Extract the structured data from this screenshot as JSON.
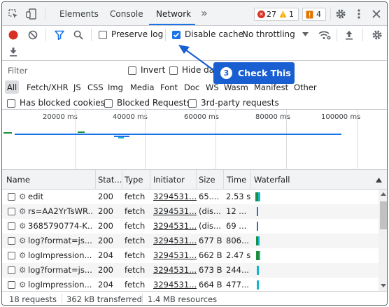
{
  "tabs": {
    "items": [
      {
        "label": "Elements"
      },
      {
        "label": "Console"
      },
      {
        "label": "Network"
      }
    ],
    "more": "»",
    "errors_count": "27",
    "warnings_count": "1",
    "issues_count": "4"
  },
  "toolbar": {
    "preserve_log": "Preserve log",
    "disable_cache": "Disable cache",
    "throttling": "No throttling"
  },
  "callout": {
    "step": "3",
    "text": "Check This"
  },
  "filter": {
    "placeholder": "Filter",
    "invert": "Invert",
    "hide_data": "Hide dat",
    "types": [
      "All",
      "Fetch/XHR",
      "JS",
      "CSS",
      "Img",
      "Media",
      "Font",
      "Doc",
      "WS",
      "Wasm",
      "Manifest",
      "Other"
    ],
    "blocked_cookies": "Has blocked cookies",
    "blocked_requests": "Blocked Requests",
    "third_party": "3rd-party requests"
  },
  "overview": {
    "ticks": [
      "20000 ms",
      "40000 ms",
      "60000 ms",
      "80000 ms",
      "100000 ms"
    ]
  },
  "table": {
    "headers": {
      "name": "Name",
      "status": "Stat...",
      "type": "Type",
      "initiator": "Initiator",
      "size": "Size",
      "time": "Time",
      "waterfall": "Waterfall"
    },
    "rows": [
      {
        "name": "edit",
        "status": "200",
        "type": "fetch",
        "initiator": "3294531...",
        "size": "65....",
        "time": "2.53 s"
      },
      {
        "name": "rs=AA2YrTsWR...",
        "status": "200",
        "type": "fetch",
        "initiator": "3294531...",
        "size": "(dis...",
        "time": "12 ..."
      },
      {
        "name": "3685790774-K...",
        "status": "200",
        "type": "fetch",
        "initiator": "3294531...",
        "size": "(dis...",
        "time": "69 ..."
      },
      {
        "name": "log?format=js...",
        "status": "200",
        "type": "fetch",
        "initiator": "3294531...",
        "size": "677 B",
        "time": "806..."
      },
      {
        "name": "logImpression...",
        "status": "204",
        "type": "fetch",
        "initiator": "3294531...",
        "size": "662 B",
        "time": "2.47 s"
      },
      {
        "name": "log?format=js...",
        "status": "200",
        "type": "fetch",
        "initiator": "3294531...",
        "size": "673 B",
        "time": "244..."
      },
      {
        "name": "logImpression...",
        "status": "204",
        "type": "fetch",
        "initiator": "3294531...",
        "size": "664 B",
        "time": "477..."
      }
    ]
  },
  "status_bar": {
    "requests": "18 requests",
    "transferred": "362 kB transferred",
    "resources": "1.4 MB resources"
  },
  "colors": {
    "accent": "#1a73e8",
    "callout": "#1a5fd1",
    "error": "#d93025",
    "warning": "#f9ab00",
    "issue": "#e37400"
  }
}
